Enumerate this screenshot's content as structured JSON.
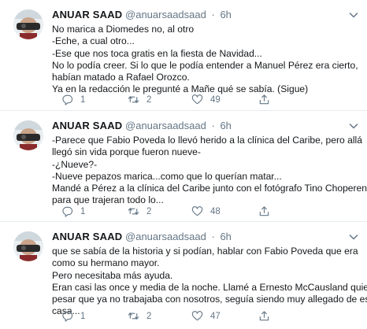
{
  "tweets": [
    {
      "name": "ANUAR SAAD",
      "handle": "@anuarsaadsaad",
      "dot": "·",
      "time": "6h",
      "lines": [
        "No marica a Diomedes no, al otro",
        "-Eche, a cual otro...",
        "-Ese que nos toca gratis en la fiesta de Navidad...",
        "No lo podía creer. Si lo que le podía entender a Manuel Pérez era cierto,",
        "habían matado a Rafael Orozco.",
        "Ya en la redacción le pregunté a Mañe qué se sabía. (Sigue)"
      ],
      "replies": "1",
      "retweets": "2",
      "likes": "49"
    },
    {
      "name": "ANUAR SAAD",
      "handle": "@anuarsaadsaad",
      "dot": "·",
      "time": "6h",
      "lines": [
        "-Parece que Fabio Poveda lo llevó herido a la clínica del Caribe, pero allá",
        "llegó sin vida porque fueron nueve-",
        "-¿Nueve?-",
        "-Nueve pepazos marica...como que lo querían matar...",
        "Mandé a Pérez a la clínica del Caribe junto con el fotógrafo Tino Choperena",
        "para que trajeran todo lo..."
      ],
      "replies": "1",
      "retweets": "2",
      "likes": "48"
    },
    {
      "name": "ANUAR SAAD",
      "handle": "@anuarsaadsaad",
      "dot": "·",
      "time": "6h",
      "lines": [
        "que se sabía de la historia y si podían, hablar con Fabio Poveda que era",
        "como su hermano mayor.",
        "Pero necesitaba más ayuda.",
        "Eran casi las once y media de la noche. Llamé a Ernesto McCausland quien a",
        "pesar que ya no trabajaba con nosotros, seguía siendo muy allegado de esa",
        "casa..."
      ],
      "replies": "1",
      "retweets": "2",
      "likes": "47"
    }
  ],
  "icons": {
    "avatar": "avatar-photo",
    "caret": "chevron-down-icon",
    "reply": "reply-icon",
    "retweet": "retweet-icon",
    "like": "heart-icon",
    "share": "share-icon"
  },
  "colors": {
    "text": "#14171a",
    "secondary": "#657786",
    "divider": "#e6ecf0"
  }
}
